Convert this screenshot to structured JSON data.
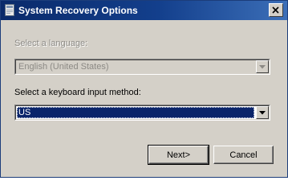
{
  "window": {
    "title": "System Recovery Options"
  },
  "language": {
    "label": "Select a language:",
    "value": "English (United States)",
    "disabled": true
  },
  "keyboard": {
    "label": "Select a keyboard input method:",
    "value": "US"
  },
  "buttons": {
    "next_label": "Next>",
    "cancel_label": "Cancel"
  },
  "colors": {
    "titlebar_start": "#0a2a6a",
    "titlebar_end": "#3c6fb8",
    "selection": "#0a246a",
    "dialog_face": "#d4d0c8"
  },
  "icons": {
    "title": "recovery-app-icon",
    "close": "close-icon",
    "dropdown": "chevron-down-icon"
  }
}
